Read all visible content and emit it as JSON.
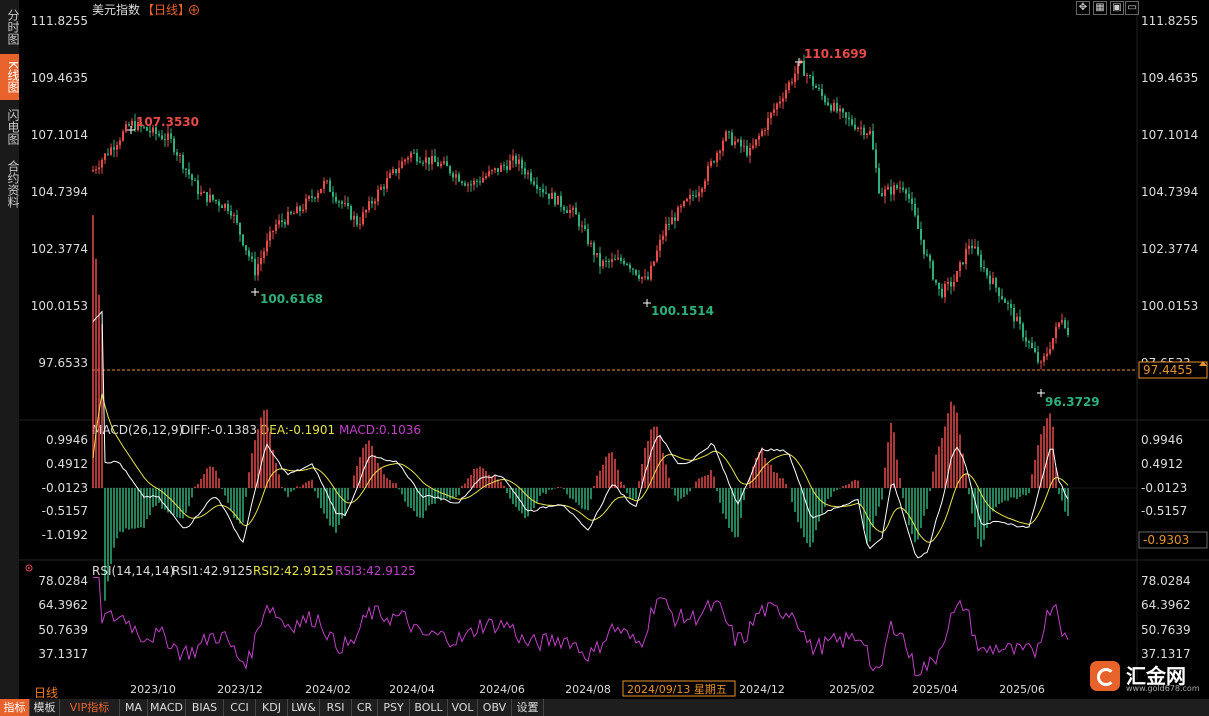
{
  "sidebar": {
    "tabs": [
      {
        "label": "分时图",
        "active": false
      },
      {
        "label": "K线图",
        "active": true
      },
      {
        "label": "闪电图",
        "active": false
      },
      {
        "label": "合约资料",
        "active": false
      }
    ]
  },
  "header": {
    "instrument": "美元指数",
    "period_tag": "【日线】",
    "add_icon": "circle-plus-icon",
    "window_buttons": [
      "move-icon",
      "grid-icon",
      "restore-icon",
      "close-icon"
    ]
  },
  "colors": {
    "up": "#e84a4a",
    "down": "#2fb07a",
    "accent": "#e8622b",
    "dea": "#e7e24a",
    "rsi": "#c040c8",
    "last_price_line": "#e8922b"
  },
  "price_panel": {
    "y_ticks": [
      "111.8255",
      "109.4635",
      "107.1014",
      "104.7394",
      "102.3774",
      "100.0153",
      "97.6533"
    ],
    "last_price": "97.4455",
    "annotations": [
      {
        "label": "107.3530",
        "type": "high"
      },
      {
        "label": "100.6168",
        "type": "low"
      },
      {
        "label": "110.1699",
        "type": "high"
      },
      {
        "label": "100.1514",
        "type": "low"
      },
      {
        "label": "96.3729",
        "type": "low"
      }
    ]
  },
  "macd_panel": {
    "title": "MACD(26,12,9)",
    "diff": "DIFF:-0.1383",
    "dea": "DEA:-0.1901",
    "macd": "MACD:0.1036",
    "y_ticks": [
      "0.9946",
      "0.4912",
      "-0.0123",
      "-0.5157",
      "-1.0192"
    ],
    "cursor_value": "-0.9303"
  },
  "rsi_panel": {
    "title": "RSI(14,14,14)",
    "rsi1": "RSI1:42.9125",
    "rsi2": "RSI2:42.9125",
    "rsi3": "RSI3:42.9125",
    "y_ticks": [
      "78.0284",
      "64.3962",
      "50.7639",
      "37.1317"
    ]
  },
  "x_axis": {
    "labels": [
      "2023/10",
      "2023/12",
      "2024/02",
      "2024/04",
      "2024/06",
      "2024/08",
      "2024/12",
      "2025/02",
      "2025/04",
      "2025/06"
    ],
    "cursor_date": "2024/09/13 星期五"
  },
  "chart_data": {
    "type": "candlestick",
    "title": "美元指数",
    "ylim": [
      96.0,
      111.8255
    ],
    "key_points": [
      {
        "label": "high",
        "value": 107.353
      },
      {
        "label": "low",
        "value": 100.6168
      },
      {
        "label": "high",
        "value": 110.1699
      },
      {
        "label": "low",
        "value": 100.1514
      },
      {
        "label": "low",
        "value": 96.3729
      }
    ],
    "last_close": 97.4455
  },
  "footer": {
    "period": "日线",
    "tabs": [
      "指标",
      "模板",
      "VIP指标",
      "MA",
      "MACD",
      "BIAS",
      "CCI",
      "KDJ",
      "LW&",
      "RSI",
      "CR",
      "PSY",
      "BOLL",
      "VOL",
      "OBV",
      "设置"
    ],
    "active_tab": "指标"
  },
  "logo": {
    "name": "汇金网",
    "url_text": "www.gold678.com"
  }
}
